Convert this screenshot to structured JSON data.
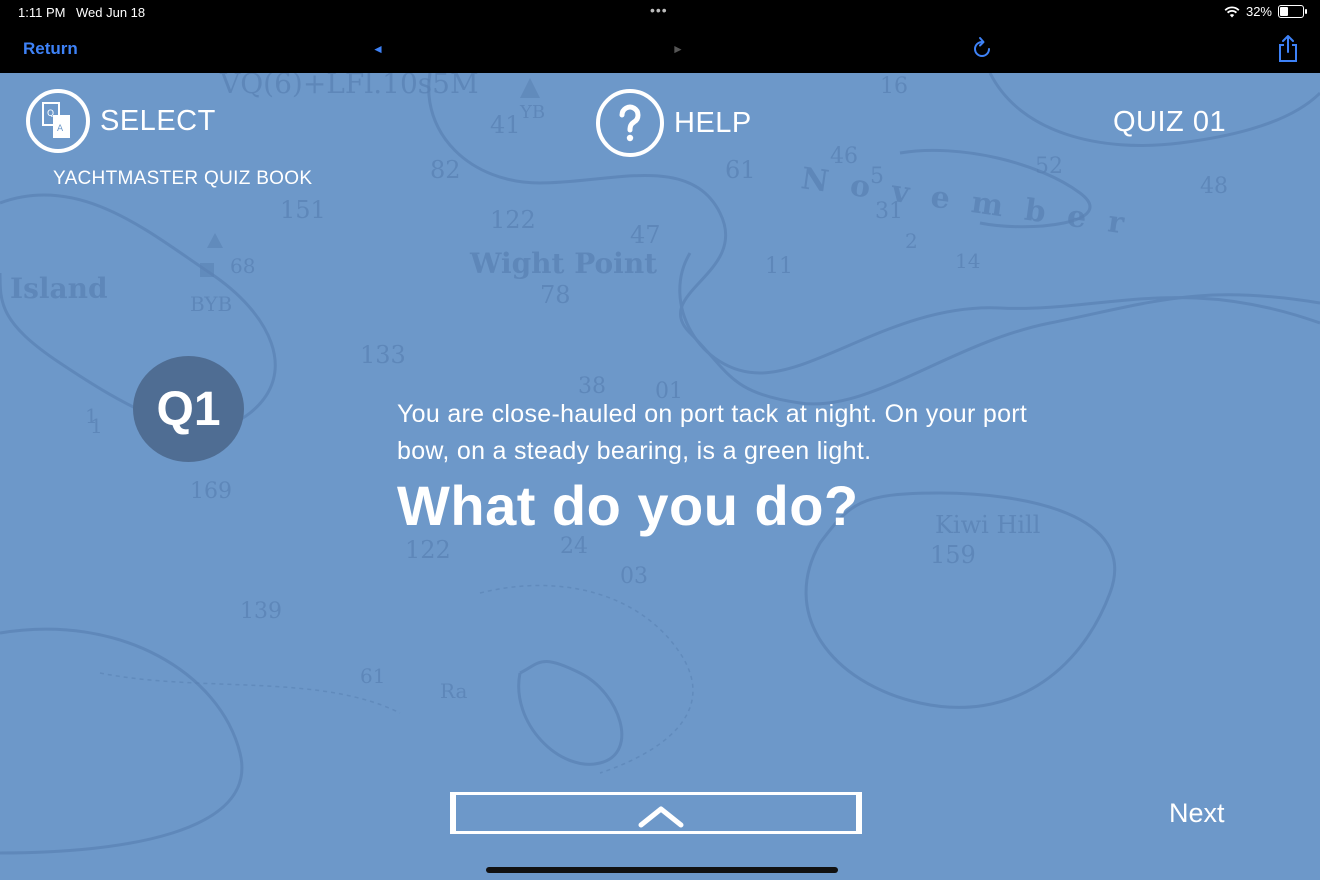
{
  "status_bar": {
    "time": "1:11 PM",
    "date": "Wed Jun 18",
    "battery": "32%",
    "battery_level": 0.32
  },
  "toolbar": {
    "return_label": "Return",
    "back_arrow": "◄",
    "forward_arrow": "►",
    "accent_color": "#3e82f7"
  },
  "header": {
    "select_label": "SELECT",
    "subtitle": "YACHTMASTER QUIZ BOOK",
    "help_label": "HELP",
    "quiz_label": "QUIZ 01"
  },
  "question": {
    "badge": "Q1",
    "text": "You are close-hauled on port tack at night. On your port bow, on a steady bearing, is a green light.",
    "prompt": "What do you do?"
  },
  "footer": {
    "next_label": "Next"
  },
  "background": {
    "chart_labels": [
      "VQ(6)+LFl.10s5M",
      "YB",
      "16",
      "5",
      "41",
      "82",
      "61",
      "Island",
      "151",
      "BYB",
      "68",
      "122",
      "Wight Point",
      "47",
      "78",
      "11",
      "November",
      "46",
      "31",
      "2",
      "14",
      "52",
      "48",
      "133",
      "38",
      "01",
      "169",
      "1",
      "122",
      "24",
      "03",
      "Kiwi Hill",
      "159",
      "139",
      "61",
      "Ra",
      "1"
    ],
    "base_color": "#6d98c9"
  }
}
